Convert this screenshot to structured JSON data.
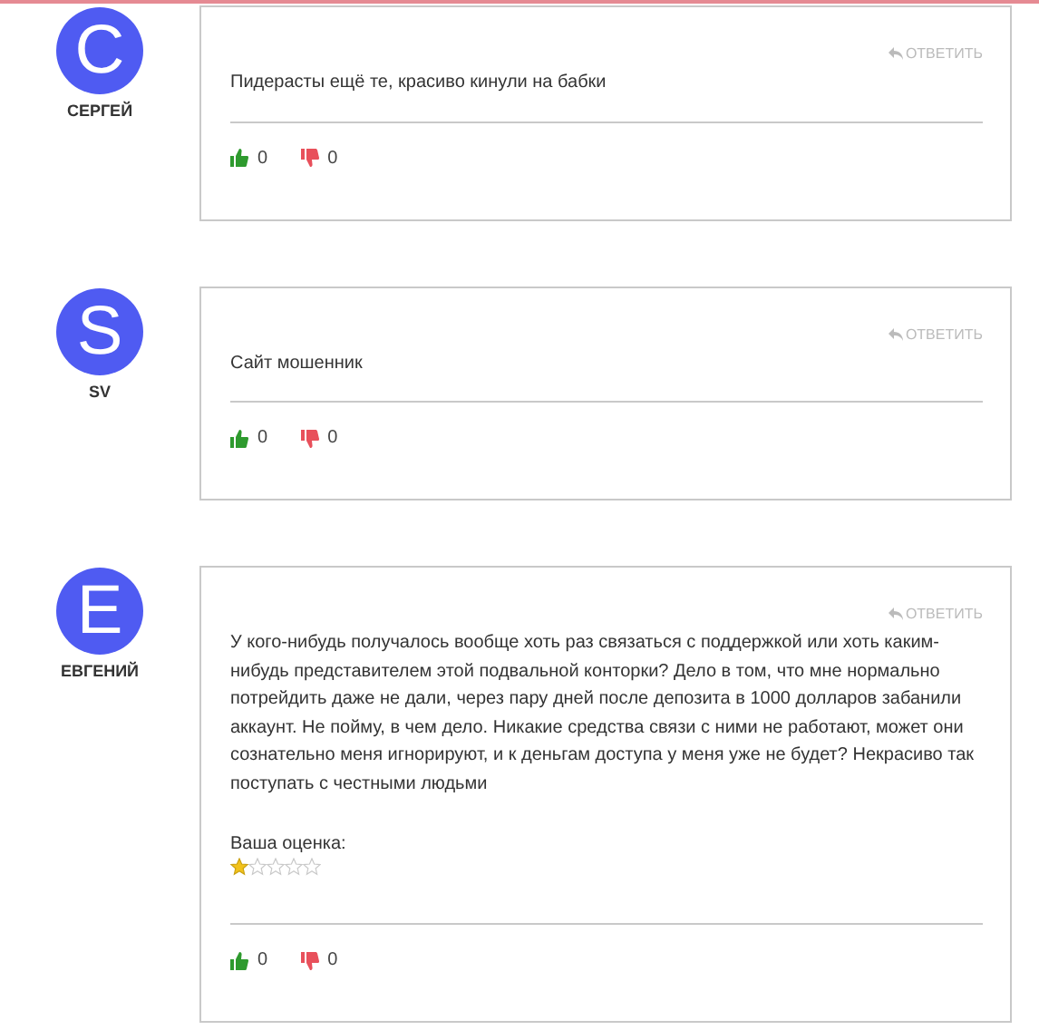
{
  "comments": [
    {
      "author": "СЕРГЕЙ",
      "initial": "C",
      "reply": "ОТВЕТИТЬ",
      "text": "Пидерасты ещё те, красиво кинули на бабки",
      "likes": "0",
      "dislikes": "0"
    },
    {
      "author": "SV",
      "initial": "S",
      "reply": "ОТВЕТИТЬ",
      "text": "Сайт мошенник",
      "likes": "0",
      "dislikes": "0"
    },
    {
      "author": "ЕВГЕНИЙ",
      "initial": "E",
      "reply": "ОТВЕТИТЬ",
      "text": "У кого-нибудь получалось вообще хоть раз связаться с поддержкой или хоть каким-нибудь представителем этой подвальной конторки? Дело в том, что мне нормально потрейдить даже не дали, через пару дней после депозита в 1000 долларов забанили аккаунт. Не пойму, в чем дело. Никакие средства связи с ними не работают, может они сознательно меня игнорируют, и к деньгам доступа у меня уже не будет? Некрасиво так поступать с честными людьми",
      "rating": {
        "label": "Ваша оценка:",
        "stars": 1
      },
      "likes": "0",
      "dislikes": "0"
    }
  ]
}
